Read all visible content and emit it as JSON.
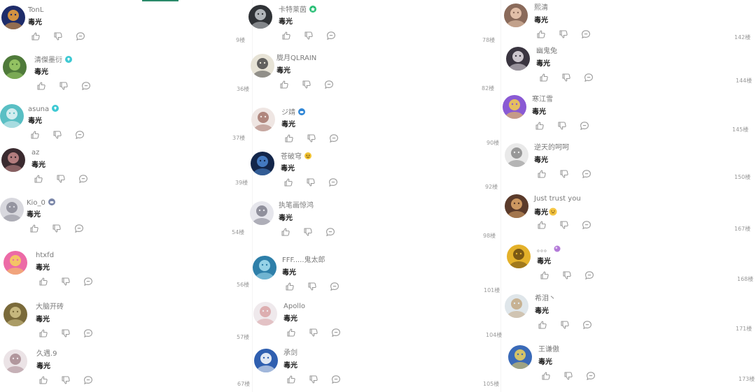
{
  "columns": [
    {
      "comments": [
        {
          "username": "TonL",
          "text": "毒光",
          "floor": "9楼",
          "badge": null,
          "avatar": {
            "bg": "#1e2c6a",
            "fg": "#f2a33a"
          }
        },
        {
          "username": "清傑墨衍",
          "text": "毒光",
          "floor": "36楼",
          "badge": "diamond",
          "avatar": {
            "bg": "#4f7a3a",
            "fg": "#9fcf6a"
          }
        },
        {
          "username": "asuna",
          "text": "毒光",
          "floor": "37楼",
          "badge": "diamond",
          "avatar": {
            "bg": "#59bfc4",
            "fg": "#e7f4f7"
          }
        },
        {
          "username": "az",
          "text": "毒光",
          "floor": "39楼",
          "badge": null,
          "avatar": {
            "bg": "#3a2a2f",
            "fg": "#c98c8c"
          }
        },
        {
          "username": "Kio_0",
          "text": "毒光",
          "floor": "54楼",
          "badge": "gamepad",
          "avatar": {
            "bg": "#d8d8de",
            "fg": "#8a8a95"
          }
        },
        {
          "username": "htxfd",
          "text": "毒光",
          "floor": "56楼",
          "badge": null,
          "avatar": {
            "bg": "#ec6aa6",
            "fg": "#f6d35a"
          }
        },
        {
          "username": "大脑开砖",
          "text": "毒光",
          "floor": "57楼",
          "badge": null,
          "avatar": {
            "bg": "#7a6a3a",
            "fg": "#d4c48a"
          }
        },
        {
          "username": "久遇.9",
          "text": "毒光",
          "floor": "67楼",
          "badge": null,
          "avatar": {
            "bg": "#ebe3e6",
            "fg": "#a7898f"
          }
        }
      ]
    },
    {
      "comments": [
        {
          "username": "卡特莱茵",
          "text": "毒光",
          "floor": "78楼",
          "badge": "flower",
          "avatar": {
            "bg": "#2f3236",
            "fg": "#c8ccd0"
          }
        },
        {
          "username": "胧月QLRAIN",
          "text": "毒光",
          "floor": "82楼",
          "badge": null,
          "avatar": {
            "bg": "#e7e3d6",
            "fg": "#4a4a4a"
          }
        },
        {
          "username": "ジ靖",
          "text": "毒光",
          "floor": "90楼",
          "badge": "gamepad-blue",
          "avatar": {
            "bg": "#efe6e3",
            "fg": "#a5756c"
          }
        },
        {
          "username": "苍破穹",
          "text": "毒光",
          "floor": "92楼",
          "badge": "face",
          "avatar": {
            "bg": "#13264a",
            "fg": "#4d88d4"
          }
        },
        {
          "username": "执笔画惊鸿",
          "text": "毒光",
          "floor": "98楼",
          "badge": null,
          "avatar": {
            "bg": "#e6e6ec",
            "fg": "#80808e"
          }
        },
        {
          "username": "FFF.....鬼太郎",
          "text": "毒光",
          "floor": "101楼",
          "badge": null,
          "avatar": {
            "bg": "#2e7fa9",
            "fg": "#a8e0f2"
          }
        },
        {
          "username": "Apollo",
          "text": "毒光",
          "floor": "104楼",
          "badge": null,
          "avatar": {
            "bg": "#efe9ec",
            "fg": "#d9a3a6"
          }
        },
        {
          "username": "承剑",
          "text": "毒光",
          "floor": "105楼",
          "badge": null,
          "avatar": {
            "bg": "#2f5fb0",
            "fg": "#ffffff"
          }
        }
      ]
    },
    {
      "comments": [
        {
          "username": "熙清",
          "text": "毒光",
          "floor": "142楼",
          "badge": null,
          "avatar": {
            "bg": "#8a6a5a",
            "fg": "#f0cdb5"
          }
        },
        {
          "username": "幽鬼兔",
          "text": "毒光",
          "floor": "144楼",
          "badge": null,
          "avatar": {
            "bg": "#3a3540",
            "fg": "#e6dfe6"
          }
        },
        {
          "username": "寒江雪",
          "text": "毒光",
          "floor": "145楼",
          "badge": null,
          "avatar": {
            "bg": "#8a5ad4",
            "fg": "#f5d04a"
          }
        },
        {
          "username": "逆天的呵呵",
          "text": "毒光",
          "floor": "150楼",
          "badge": null,
          "avatar": {
            "bg": "#e9e9e9",
            "fg": "#8a8a8a"
          }
        },
        {
          "username": "Just trust you",
          "text": "毒光",
          "floor": "167楼",
          "badge": null,
          "emoji": true,
          "avatar": {
            "bg": "#5a3a2a",
            "fg": "#e0a86a"
          }
        },
        {
          "username": "。。。",
          "text": "毒光",
          "floor": "168楼",
          "badge": "orb",
          "avatar": {
            "bg": "#e4b12a",
            "fg": "#6a4a10"
          }
        },
        {
          "username": "希泪丶",
          "text": "毒光",
          "floor": "171楼",
          "badge": null,
          "avatar": {
            "bg": "#dfe6ea",
            "fg": "#c3a884"
          }
        },
        {
          "username": "王谦傲",
          "text": "毒光",
          "floor": "173楼",
          "badge": null,
          "avatar": {
            "bg": "#3a6ab8",
            "fg": "#f0d25a"
          }
        }
      ]
    }
  ],
  "colors": {
    "username": "#7a7a7a",
    "text": "#1a1a1a",
    "icon": "#9a9a9a",
    "floor": "#9a9a9a"
  },
  "icons": {
    "like": "thumbs-up-icon",
    "dislike": "thumbs-down-icon",
    "reply": "comment-icon"
  }
}
